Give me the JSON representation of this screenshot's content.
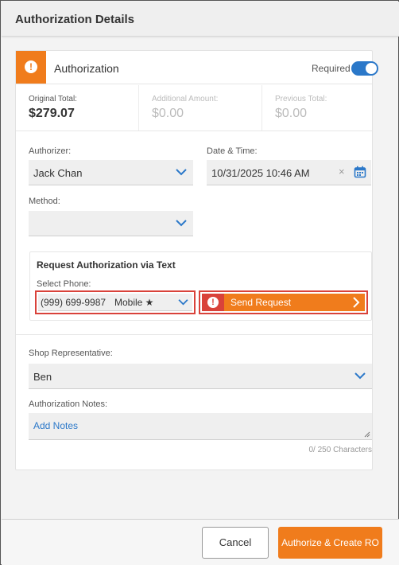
{
  "header": {
    "title": "Authorization Details"
  },
  "authorization": {
    "title": "Authorization",
    "required_label": "Required",
    "required_on": true,
    "alert_glyph": "!"
  },
  "totals": {
    "original": {
      "label": "Original Total:",
      "value": "$279.07"
    },
    "additional": {
      "label": "Additional Amount:",
      "value": "$0.00"
    },
    "previous": {
      "label": "Previous Total:",
      "value": "$0.00"
    }
  },
  "authorizer": {
    "label": "Authorizer:",
    "value": "Jack Chan"
  },
  "datetime": {
    "label": "Date & Time:",
    "value": "10/31/2025 10:46 AM",
    "clear_glyph": "×"
  },
  "method": {
    "label": "Method:",
    "value": ""
  },
  "text_request": {
    "title": "Request Authorization via Text",
    "phone_label": "Select Phone:",
    "phone_number": "(999) 699-9987",
    "phone_type": "Mobile ★",
    "send_label": "Send Request"
  },
  "shop_rep": {
    "label": "Shop Representative:",
    "value": "Ben"
  },
  "notes": {
    "label": "Authorization Notes:",
    "placeholder": "Add Notes",
    "char_count": "0/ 250 Characters"
  },
  "footer": {
    "cancel_label": "Cancel",
    "authorize_label": "Authorize & Create RO"
  },
  "colors": {
    "accent_orange": "#f07c1c",
    "accent_blue": "#2b78c9",
    "alert_red": "#d9423a"
  }
}
